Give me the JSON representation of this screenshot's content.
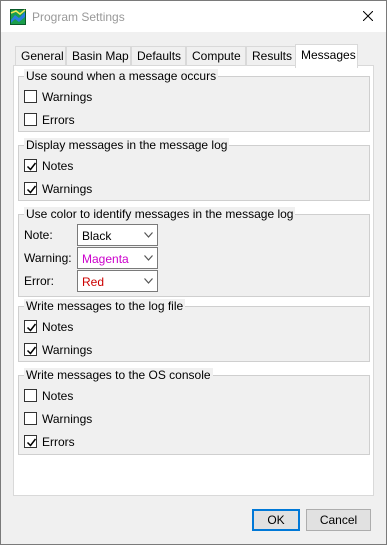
{
  "window": {
    "title": "Program Settings",
    "app_icon": "map-icon",
    "close_icon": "close-icon"
  },
  "tabs": [
    {
      "label": "General",
      "active": false
    },
    {
      "label": "Basin Map",
      "active": false
    },
    {
      "label": "Defaults",
      "active": false
    },
    {
      "label": "Compute",
      "active": false
    },
    {
      "label": "Results",
      "active": false
    },
    {
      "label": "Messages",
      "active": true
    }
  ],
  "groups": {
    "sound": {
      "title": "Use sound when a message occurs",
      "items": [
        {
          "label": "Warnings",
          "checked": false
        },
        {
          "label": "Errors",
          "checked": false
        }
      ]
    },
    "display_log": {
      "title": "Display messages in the message log",
      "items": [
        {
          "label": "Notes",
          "checked": true
        },
        {
          "label": "Warnings",
          "checked": true
        }
      ]
    },
    "color": {
      "title": "Use color to identify messages in the message log",
      "rows": [
        {
          "label": "Note:",
          "value": "Black",
          "color": "#000000"
        },
        {
          "label": "Warning:",
          "value": "Magenta",
          "color": "#cc00cc"
        },
        {
          "label": "Error:",
          "value": "Red",
          "color": "#cc0000"
        }
      ]
    },
    "log_file": {
      "title": "Write messages to the log file",
      "items": [
        {
          "label": "Notes",
          "checked": true
        },
        {
          "label": "Warnings",
          "checked": true
        }
      ]
    },
    "os_console": {
      "title": "Write messages to the OS console",
      "items": [
        {
          "label": "Notes",
          "checked": false
        },
        {
          "label": "Warnings",
          "checked": false
        },
        {
          "label": "Errors",
          "checked": true
        }
      ]
    }
  },
  "buttons": {
    "ok": "OK",
    "cancel": "Cancel"
  },
  "colors": {
    "accent": "#0078d7",
    "window_bg": "#f0f0f0"
  }
}
